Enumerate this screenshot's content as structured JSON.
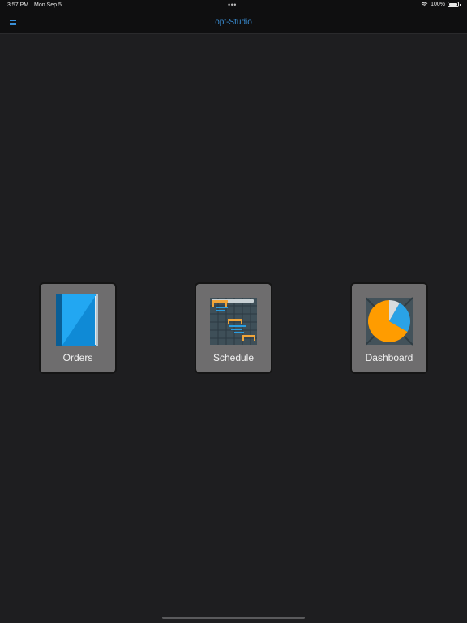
{
  "status_bar": {
    "time": "3:57 PM",
    "date": "Mon Sep 5",
    "dots": "•••",
    "battery": "100%",
    "icons": [
      "wifi-icon",
      "battery-icon"
    ]
  },
  "nav": {
    "title": "opt-Studio",
    "menu_icon": "hamburger-menu-icon"
  },
  "tiles": [
    {
      "label": "Orders",
      "icon": "book-icon"
    },
    {
      "label": "Schedule",
      "icon": "gantt-chart-icon"
    },
    {
      "label": "Dashboard",
      "icon": "pie-chart-icon"
    }
  ],
  "colors": {
    "background": "#1e1e20",
    "bar": "#0f0f10",
    "accent": "#3a8fd6",
    "tile": "#6e6d6e",
    "book_blue": "#1ea0f0",
    "pie_orange": "#ff9c00"
  }
}
